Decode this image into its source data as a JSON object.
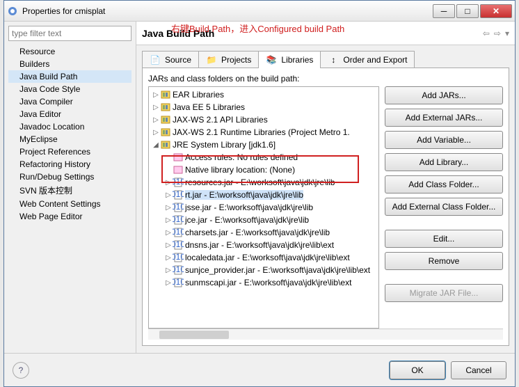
{
  "window": {
    "title": "Properties for cmisplat"
  },
  "annotation": "右键Build Path，进入Configured build Path",
  "filter_placeholder": "type filter text",
  "categories": [
    "Resource",
    "Builders",
    "Java Build Path",
    "Java Code Style",
    "Java Compiler",
    "Java Editor",
    "Javadoc Location",
    "MyEclipse",
    "Project References",
    "Refactoring History",
    "Run/Debug Settings",
    "SVN 版本控制",
    "Web Content Settings",
    "Web Page Editor"
  ],
  "selected_category_index": 2,
  "page_title": "Java Build Path",
  "tabs": [
    "Source",
    "Projects",
    "Libraries",
    "Order and Export"
  ],
  "active_tab_index": 2,
  "instruction": "JARs and class folders on the build path:",
  "tree": {
    "top": [
      "EAR Libraries",
      "Java EE 5 Libraries",
      "JAX-WS 2.1 API Libraries",
      "JAX-WS 2.1 Runtime Libraries (Project Metro 1."
    ],
    "jre_label": "JRE System Library [jdk1.6]",
    "jre_children": [
      "Access rules: No rules defined",
      "Native library location: (None)",
      "resources.jar - E:\\worksoft\\java\\jdk\\jre\\lib",
      "rt.jar - E:\\worksoft\\java\\jdk\\jre\\lib",
      "jsse.jar - E:\\worksoft\\java\\jdk\\jre\\lib",
      "jce.jar - E:\\worksoft\\java\\jdk\\jre\\lib",
      "charsets.jar - E:\\worksoft\\java\\jdk\\jre\\lib",
      "dnsns.jar - E:\\worksoft\\java\\jdk\\jre\\lib\\ext",
      "localedata.jar - E:\\worksoft\\java\\jdk\\jre\\lib\\ext",
      "sunjce_provider.jar - E:\\worksoft\\java\\jdk\\jre\\lib\\ext",
      "sunmscapi.jar - E:\\worksoft\\java\\jdk\\jre\\lib\\ext"
    ],
    "selected_child_index": 3
  },
  "buttons": [
    "Add JARs...",
    "Add External JARs...",
    "Add Variable...",
    "Add Library...",
    "Add Class Folder...",
    "Add External Class Folder...",
    "Edit...",
    "Remove",
    "Migrate JAR File..."
  ],
  "disabled_button_index": 8,
  "footer": {
    "ok": "OK",
    "cancel": "Cancel"
  }
}
